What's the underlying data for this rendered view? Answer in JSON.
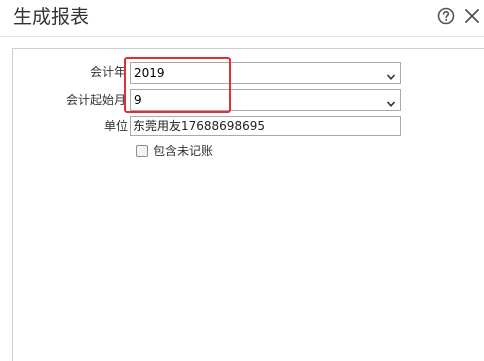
{
  "dialog": {
    "title": "生成报表"
  },
  "form": {
    "year": {
      "label": "会计年",
      "value": "2019"
    },
    "start_month": {
      "label": "会计起始月",
      "value": "9"
    },
    "unit": {
      "label": "单位",
      "value": "东莞用友17688698695"
    },
    "include_unposted": {
      "label": "包含未记账",
      "checked": false
    }
  },
  "icons": {
    "help": "help-circle-icon",
    "close": "close-icon",
    "dropdown": "chevron-down-icon"
  },
  "colors": {
    "highlight": "#e03030",
    "border": "#a9a9a9"
  }
}
